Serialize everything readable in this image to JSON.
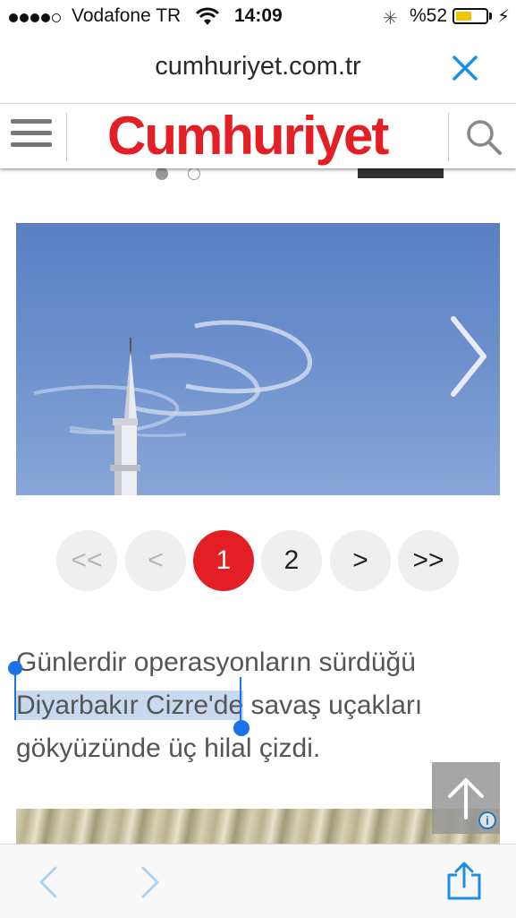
{
  "status_bar": {
    "carrier": "Vodafone TR",
    "time": "14:09",
    "battery_percent": "%52",
    "battery_level": 0.52,
    "signal_bars": 4
  },
  "url_bar": {
    "url": "cumhuriyet.com.tr",
    "close_icon": "close-icon"
  },
  "site_header": {
    "logo": "Cumhuriyet",
    "menu_icon": "hamburger-menu-icon",
    "search_icon": "search-icon"
  },
  "carousel": {
    "indicator_count": 2,
    "active_index": 0,
    "next_icon": "chevron-right-icon"
  },
  "pagination": {
    "first": "<<",
    "prev": "<",
    "pages": [
      "1",
      "2"
    ],
    "current_page": "1",
    "next": ">",
    "last": ">>"
  },
  "article": {
    "line1": "Günlerdir operasyonların sürdüğü",
    "highlighted": "Diyarbakır Cizre'de",
    "rest": " savaş uçakları gökyüzünde üç hilal çizdi."
  },
  "ad": {
    "info_badge": "i"
  },
  "toolbar": {
    "back_icon": "back-arrow-icon",
    "forward_icon": "forward-arrow-icon",
    "share_icon": "share-icon"
  },
  "colors": {
    "brand_red": "#e31e24",
    "ios_blue": "#1a8fe3",
    "selection_blue": "#1a73e8"
  }
}
